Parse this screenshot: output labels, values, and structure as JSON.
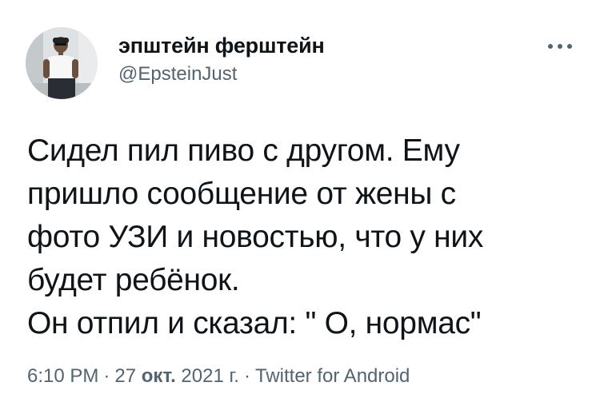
{
  "author": {
    "display_name": "эпштейн ферштейн",
    "handle": "@EpsteinJust"
  },
  "more_icon": "more-horizontal-icon",
  "tweet": {
    "lines": [
      "Сидел пил пиво с другом. Ему",
      "пришло сообщение от жены с",
      "фото УЗИ и новостью, что у них",
      "будет ребёнок.",
      "Он отпил и сказал: \" О, нормас\""
    ]
  },
  "meta": {
    "time": "6:10 PM",
    "separator": "·",
    "date_day": "27",
    "date_month": "окт.",
    "date_year": "2021 г.",
    "source": "Twitter for Android"
  },
  "colors": {
    "text_primary": "#0f1419",
    "text_secondary": "#536471",
    "background": "#ffffff"
  }
}
